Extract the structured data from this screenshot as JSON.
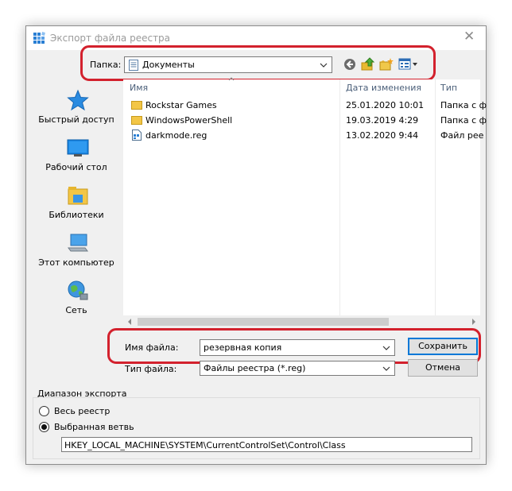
{
  "window": {
    "title": "Экспорт файла реестра",
    "close_glyph": "✕"
  },
  "toolbar": {
    "folder_label": "Папка:",
    "folder_value": "Документы"
  },
  "places": [
    {
      "label": "Быстрый доступ",
      "icon": "star-icon"
    },
    {
      "label": "Рабочий стол",
      "icon": "desktop-icon"
    },
    {
      "label": "Библиотеки",
      "icon": "libraries-icon"
    },
    {
      "label": "Этот компьютер",
      "icon": "computer-icon"
    },
    {
      "label": "Сеть",
      "icon": "network-icon"
    }
  ],
  "filelist": {
    "columns": [
      "Имя",
      "Дата изменения",
      "Тип"
    ],
    "rows": [
      {
        "name": "Rockstar Games",
        "date": "25.01.2020 10:01",
        "type": "Папка с ф",
        "icon": "folder-icon"
      },
      {
        "name": "WindowsPowerShell",
        "date": "19.03.2019 4:29",
        "type": "Папка с ф",
        "icon": "folder-icon"
      },
      {
        "name": "darkmode.reg",
        "date": "13.02.2020 9:44",
        "type": "Файл рее",
        "icon": "reg-file-icon"
      }
    ]
  },
  "save_area": {
    "filename_label": "Имя файла:",
    "filename_value": "резервная копия",
    "filetype_label": "Тип файла:",
    "filetype_value": "Файлы реестра (*.reg)",
    "save_label": "Сохранить",
    "cancel_label": "Отмена"
  },
  "export_range": {
    "title": "Диапазон экспорта",
    "option_all": "Весь реестр",
    "option_branch": "Выбранная ветвь",
    "selected": "option_branch",
    "branch_path": "HKEY_LOCAL_MACHINE\\SYSTEM\\CurrentControlSet\\Control\\Class"
  },
  "colors": {
    "highlight": "#d3212d",
    "accent": "#0078d7",
    "dialog_bg": "#f0f0f0",
    "header_text": "#4c607a"
  }
}
